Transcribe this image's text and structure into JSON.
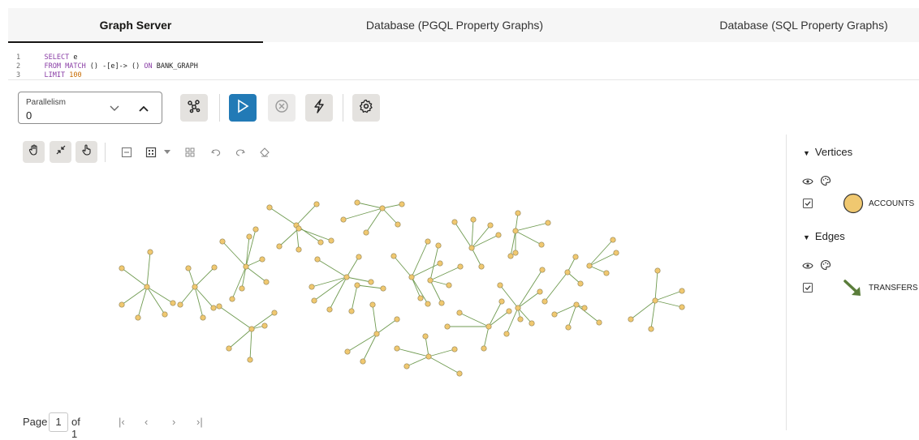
{
  "tabs": [
    {
      "label": "Graph Server",
      "active": true
    },
    {
      "label": "Database (PGQL Property Graphs)",
      "active": false
    },
    {
      "label": "Database (SQL Property Graphs)",
      "active": false
    }
  ],
  "editor": {
    "lines": [
      {
        "num": "1",
        "kw1": "SELECT",
        "rest": " e"
      },
      {
        "num": "2",
        "kw1": "FROM",
        "kw2": "MATCH",
        "mid": " () -[e]-> () ",
        "kw3": "ON",
        "tail": " BANK_GRAPH"
      },
      {
        "num": "3",
        "kw1": "LIMIT",
        "value": "100"
      }
    ]
  },
  "parallelism": {
    "label": "Parallelism",
    "value": "0"
  },
  "toolbar": {
    "graph_icon": "graph-settings-icon",
    "run_icon": "play-icon",
    "cancel_icon": "cancel-icon",
    "quick_icon": "lightning-icon",
    "settings_icon": "gear-icon"
  },
  "legend": {
    "vertices_title": "Vertices",
    "vertex_label": "ACCOUNTS",
    "edges_title": "Edges",
    "edge_label": "TRANSFERS",
    "vertex_color": "#f0c870",
    "edge_color": "#5a7d3a"
  },
  "pager": {
    "prefix": "Page",
    "page": "1",
    "of": "of 1"
  },
  "graph": {
    "vertex_color": "#f0c870",
    "vertex_stroke": "#9a8a5a",
    "edge_color": "#6f9a50"
  }
}
